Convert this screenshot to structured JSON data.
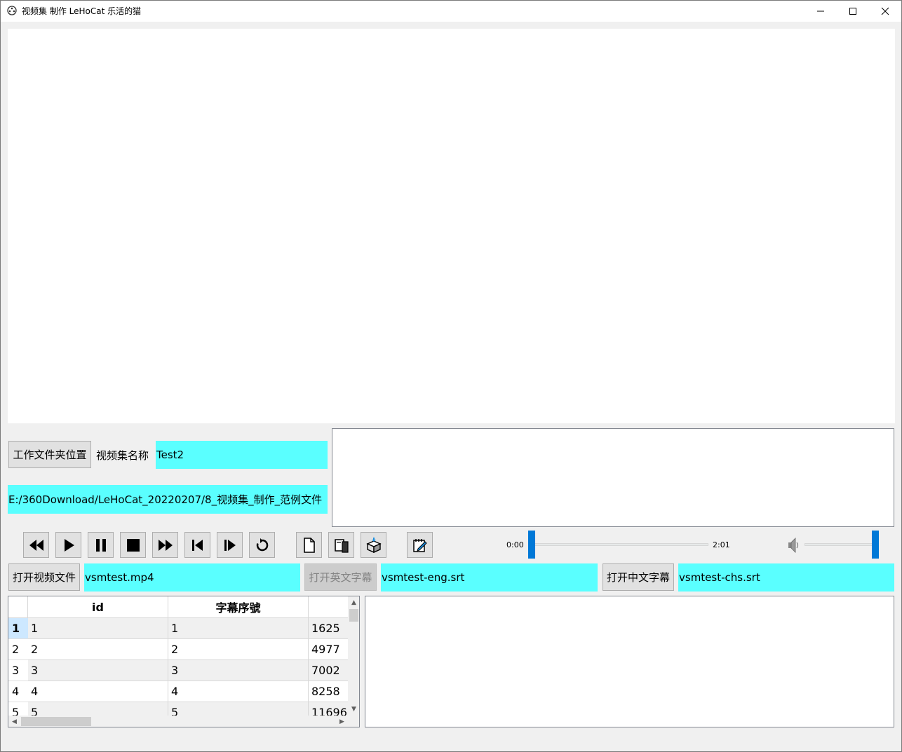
{
  "window": {
    "title": "视频集 制作  LeHoCat 乐活的猫",
    "minimize_glyph": "—",
    "maximize_glyph": "☐",
    "close_glyph": "✕"
  },
  "workspace": {
    "folder_button": "工作文件夹位置",
    "collection_label": "视频集名称",
    "collection_name": "Test2",
    "folder_path": "E:/360Download/LeHoCat_20220207/8_视频集_制作_范例文件"
  },
  "toolbar": {
    "buttons": [
      "rewind-icon",
      "play-icon",
      "pause-icon",
      "stop-icon",
      "fast-forward-icon",
      "step-back-icon",
      "step-forward-icon",
      "replay-icon",
      "new-file-icon",
      "open-file-icon",
      "package-icon",
      "edit-icon"
    ]
  },
  "player": {
    "current_time": "0:00",
    "total_time": "2:01",
    "progress": 0.0,
    "volume": 1.0,
    "volume_icon": "speaker-icon"
  },
  "files": {
    "open_video_button": "打开视频文件",
    "video_file": "vsmtest.mp4",
    "open_eng_sub_button": "打开英文字幕",
    "eng_sub_file": "vsmtest-eng.srt",
    "open_chs_sub_button": "打开中文字幕",
    "chs_sub_file": "vsmtest-chs.srt"
  },
  "table": {
    "columns": [
      "id",
      "字幕序號",
      ""
    ],
    "rows": [
      {
        "num": "1",
        "id": "1",
        "seq": "1",
        "start": "1625"
      },
      {
        "num": "2",
        "id": "2",
        "seq": "2",
        "start": "4977"
      },
      {
        "num": "3",
        "id": "3",
        "seq": "3",
        "start": "7002"
      },
      {
        "num": "4",
        "id": "4",
        "seq": "4",
        "start": "8258"
      },
      {
        "num": "5",
        "id": "5",
        "seq": "5",
        "start": "11696"
      }
    ],
    "selected_row": "1"
  },
  "colors": {
    "accent": "#0078d7",
    "field_highlight": "#5affff"
  }
}
